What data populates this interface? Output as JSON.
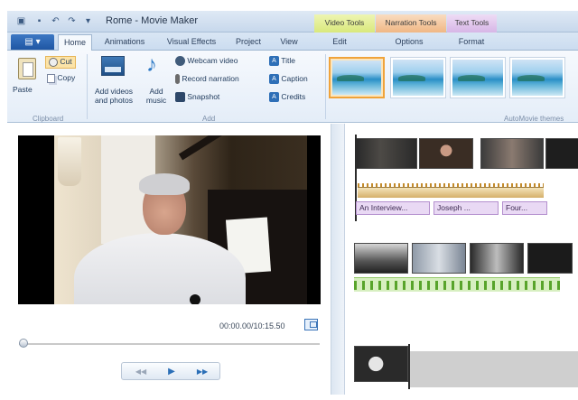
{
  "window": {
    "title": "Rome - Movie Maker",
    "context_tabs": [
      "Video Tools",
      "Narration Tools",
      "Text Tools"
    ]
  },
  "tabs": {
    "file": "",
    "items": [
      "Home",
      "Animations",
      "Visual Effects",
      "Project",
      "View",
      "Edit",
      "Options",
      "Format"
    ],
    "active": "Home"
  },
  "ribbon": {
    "clipboard": {
      "paste": "Paste",
      "cut": "Cut",
      "copy": "Copy",
      "label": "Clipboard"
    },
    "add": {
      "add_videos": [
        "Add videos",
        "and photos"
      ],
      "add_music": [
        "Add",
        "music"
      ],
      "webcam": "Webcam video",
      "record_narration": "Record narration",
      "snapshot": "Snapshot",
      "title": "Title",
      "caption": "Caption",
      "credits": "Credits",
      "label": "Add"
    },
    "automovie_label": "AutoMovie themes"
  },
  "preview": {
    "timecode": "00:00.00/10:15.50",
    "controls": {
      "prev": "◀◀",
      "play": "▶",
      "next": "▶▶"
    }
  },
  "storyboard": {
    "captions": [
      "An Interview...",
      "Joseph ...",
      "Four..."
    ]
  }
}
